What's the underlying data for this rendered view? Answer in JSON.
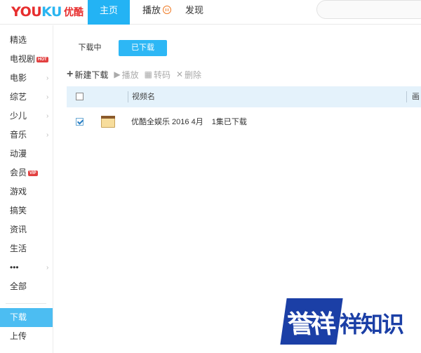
{
  "header": {
    "logo_en_1": "YOU",
    "logo_en_2": "KU",
    "logo_cn": "优酷",
    "tabs": [
      {
        "label": "主页",
        "active": true
      },
      {
        "label": "播放",
        "active": false,
        "icon": "pause-badge-icon"
      },
      {
        "label": "发现",
        "active": false
      }
    ]
  },
  "sidebar": {
    "items": [
      {
        "label": "精选"
      },
      {
        "label": "电视剧",
        "tag": "HOT"
      },
      {
        "label": "电影",
        "chevron": "›"
      },
      {
        "label": "综艺",
        "chevron": "›"
      },
      {
        "label": "少儿",
        "chevron": "›"
      },
      {
        "label": "音乐",
        "chevron": "›"
      },
      {
        "label": "动漫"
      },
      {
        "label": "会员",
        "tag": "VIP"
      },
      {
        "label": "游戏"
      },
      {
        "label": "搞笑"
      },
      {
        "label": "资讯"
      },
      {
        "label": "生活"
      },
      {
        "label": "•••",
        "chevron": "›"
      },
      {
        "label": "全部"
      },
      {
        "label": "下载",
        "active": true
      },
      {
        "label": "上传"
      }
    ]
  },
  "download": {
    "tabs": [
      "下载中",
      "已下载"
    ],
    "active_tab": "已下载",
    "toolbar": {
      "new_download": "新建下载",
      "play": "播放",
      "convert": "转码",
      "delete": "删除"
    },
    "columns": [
      "视频名",
      "画质"
    ],
    "column_partial": "画",
    "rows": [
      {
        "checked": true,
        "name": "优酷全娱乐 2016 4月",
        "status": "1集已下载"
      }
    ]
  },
  "watermark": {
    "badge": "誉祥",
    "rest": "祥知识"
  },
  "colors": {
    "accent_blue": "#23b3f4",
    "logo_red": "#e72e2e",
    "logo_blue": "#2ab5f0",
    "watermark_blue": "#1b3fa6",
    "table_header_bg": "#e4f2fb"
  }
}
